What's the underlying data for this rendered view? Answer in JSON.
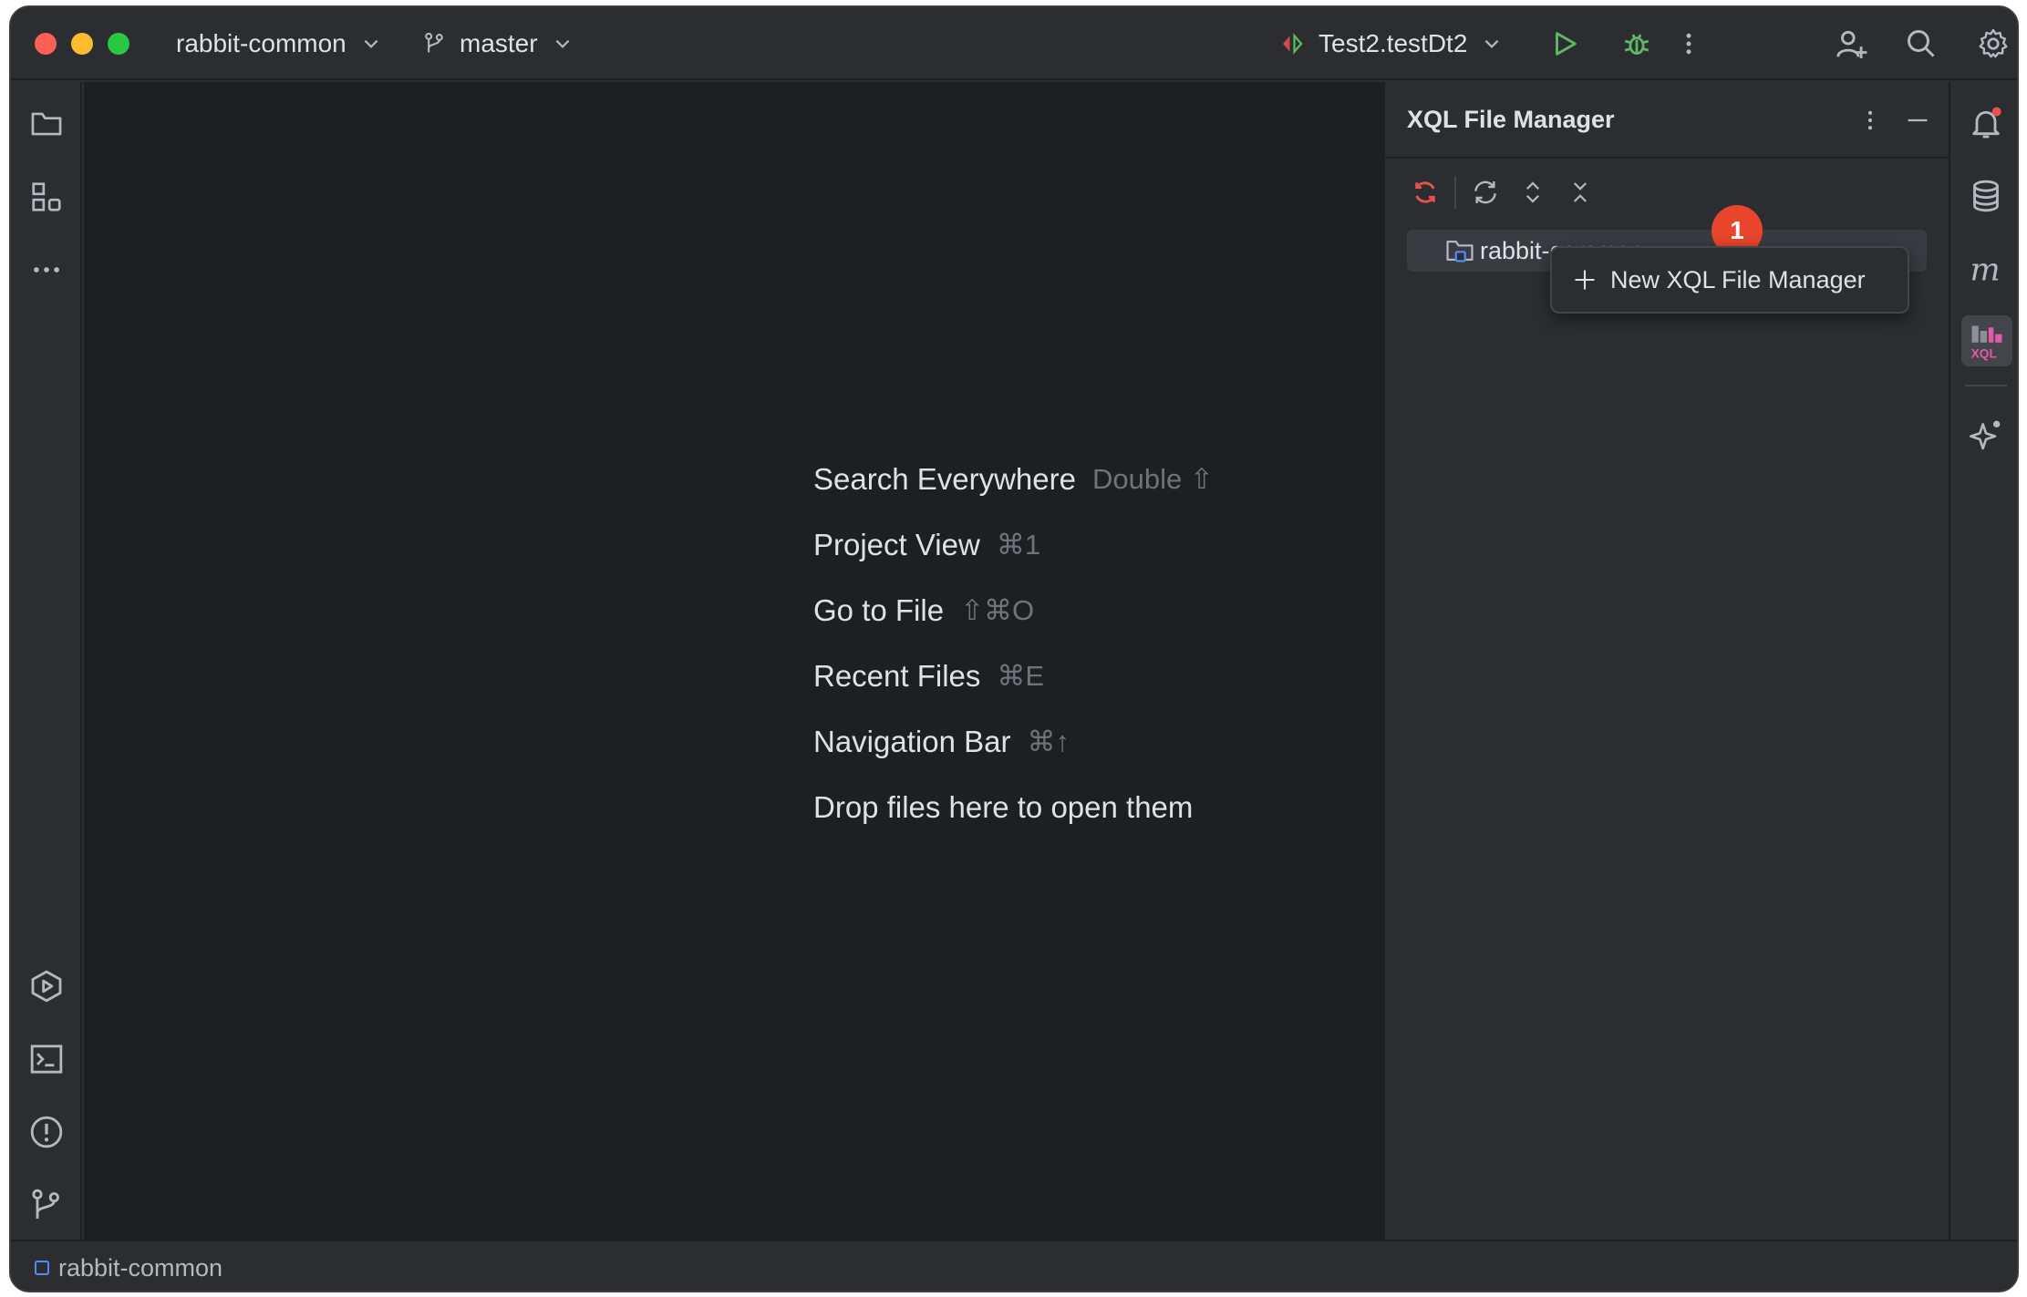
{
  "window": {
    "project_name": "rabbit-common",
    "branch_name": "master",
    "run_config": "Test2.testDt2"
  },
  "editor": {
    "hints": [
      {
        "label": "Search Everywhere",
        "shortcut": "Double ⇧"
      },
      {
        "label": "Project View",
        "shortcut": "⌘1"
      },
      {
        "label": "Go to File",
        "shortcut": "⇧⌘O"
      },
      {
        "label": "Recent Files",
        "shortcut": "⌘E"
      },
      {
        "label": "Navigation Bar",
        "shortcut": "⌘↑"
      },
      {
        "label": "Drop files here to open them",
        "shortcut": ""
      }
    ]
  },
  "panel": {
    "title": "XQL File Manager",
    "tree_item": "rabbit-common",
    "badge_count": "1",
    "popup_label": "New XQL File Manager"
  },
  "statusbar": {
    "project": "rabbit-common"
  },
  "colors": {
    "accent_blue": "#548af7",
    "run_green": "#5fb865",
    "badge_red": "#e8452c",
    "refresh_red": "#e5534b"
  },
  "icons": {
    "left": [
      "folder-icon",
      "structure-icon",
      "more-icon",
      "run-services-icon",
      "terminal-icon",
      "problems-icon",
      "git-icon"
    ],
    "right": [
      "notifications-icon",
      "database-icon",
      "maven-icon",
      "xql-icon",
      "ai-assistant-icon"
    ],
    "title": [
      "branch-icon",
      "run-config-icon",
      "run-icon",
      "debug-icon",
      "kebab-icon",
      "add-user-icon",
      "search-icon",
      "settings-icon"
    ]
  }
}
